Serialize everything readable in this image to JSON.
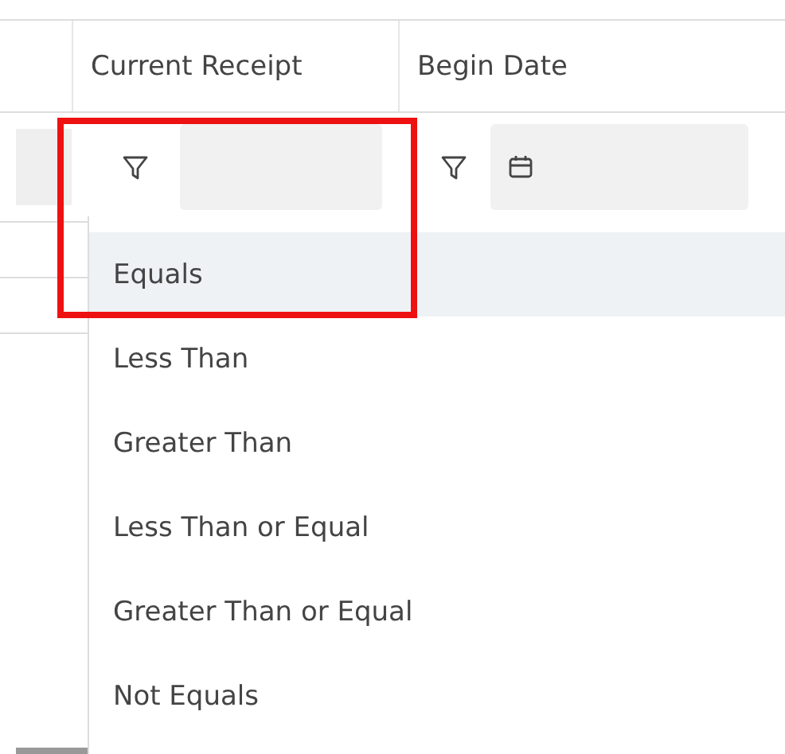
{
  "table": {
    "columns": [
      {
        "label": "Current Receipt",
        "kind": "text"
      },
      {
        "label": "Begin Date",
        "kind": "date"
      }
    ]
  },
  "filter_menu": {
    "options": [
      {
        "label": "Equals",
        "selected": true
      },
      {
        "label": "Less Than",
        "selected": false
      },
      {
        "label": "Greater Than",
        "selected": false
      },
      {
        "label": "Less Than or Equal",
        "selected": false
      },
      {
        "label": "Greater Than or Equal",
        "selected": false
      },
      {
        "label": "Not Equals",
        "selected": false
      }
    ]
  }
}
